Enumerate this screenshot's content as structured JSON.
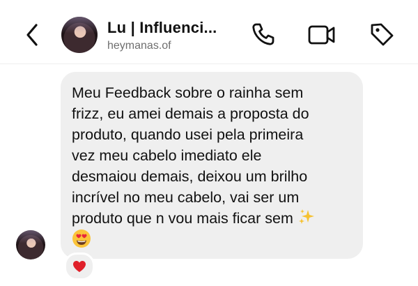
{
  "header": {
    "title": "Lu | Influenci...",
    "subtitle": "heymanas.of",
    "icons": [
      "back-chevron-icon",
      "phone-icon",
      "video-camera-icon",
      "tag-icon"
    ]
  },
  "message": {
    "lines": [
      "Meu Feedback sobre o rainha sem",
      "frizz, eu amei demais a proposta do",
      "produto, quando usei pela primeira",
      "vez meu cabelo imediato ele",
      "desmaiou demais, deixou um brilho",
      "incrível no meu cabelo, vai ser um",
      "produto que n vou mais ficar sem"
    ],
    "emojis": [
      "sparkles",
      "heart-eyes-face"
    ]
  },
  "reaction": {
    "emoji": "red-heart",
    "color": "#e0202a"
  },
  "colors": {
    "bubble": "#efefef",
    "subtitle": "#6e6e6e",
    "divider": "#efefef"
  }
}
